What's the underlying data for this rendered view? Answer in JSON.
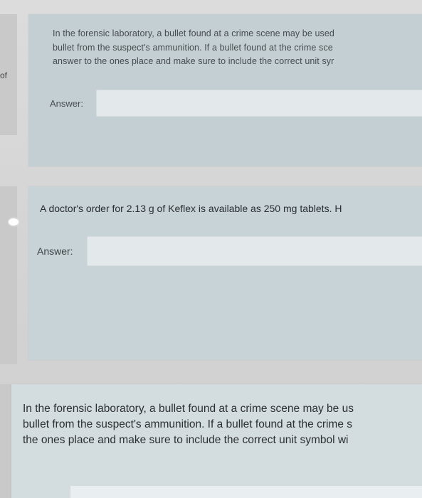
{
  "left_fragment": "of",
  "questions": [
    {
      "lines": [
        "In the forensic laboratory, a bullet found at a crime scene may be used",
        "bullet from the suspect's ammunition. If a bullet found at the crime sce",
        "answer to the ones place and make sure to include the correct unit syr"
      ],
      "answer_label": "Answer:",
      "answer_value": ""
    },
    {
      "lines": [
        "A doctor's order for 2.13 g of Keflex is available as 250 mg tablets. H"
      ],
      "answer_label": "Answer:",
      "answer_value": ""
    },
    {
      "lines": [
        "In the forensic laboratory, a bullet found at a crime scene may be us",
        "bullet from the suspect's ammunition. If a bullet found at the crime s",
        "the ones place and make sure to include the correct unit symbol wi"
      ],
      "answer_value": ""
    }
  ],
  "colors": {
    "page_background": "#d9d9d9",
    "question_card": "#c6d2d6",
    "answer_field": "#e3e8ea"
  }
}
